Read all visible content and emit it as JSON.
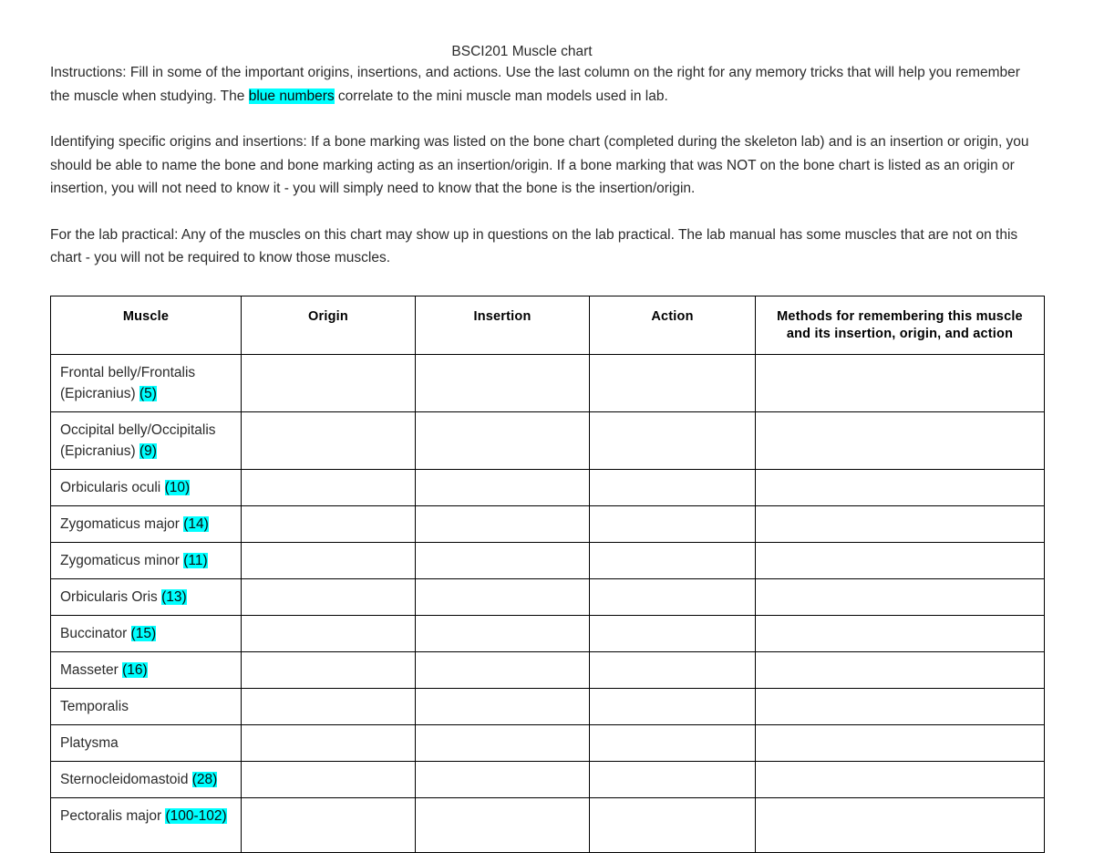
{
  "document": {
    "title": "BSCI201 Muscle chart",
    "paragraphs": {
      "instructions_part1": "Instructions: Fill in some of the important origins, insertions, and actions. Use the last column on the right for any memory tricks that will help you remember the muscle when studying. The ",
      "instructions_highlight": "blue numbers",
      "instructions_part2": " correlate to the mini muscle man models used in lab.",
      "identifying": "Identifying specific origins and insertions: If a bone marking was listed on the bone chart (completed during the skeleton lab) and is an insertion or origin, you should be able to name the bone and bone marking acting as an insertion/origin. If a bone marking that was NOT on the bone chart is listed as an origin or insertion, you will not need to know it - you will simply need to know that the bone is the insertion/origin.",
      "lab_practical": "For the lab practical: Any of the muscles on this chart may show up in questions on the lab practical. The lab manual has some muscles that are not on this chart - you will not be required to know those muscles."
    }
  },
  "colors": {
    "highlight": "#00ffff",
    "text": "#2b2b2b",
    "border": "#000000"
  },
  "table": {
    "headers": {
      "muscle": "Muscle",
      "origin": "Origin",
      "insertion": "Insertion",
      "action": "Action",
      "methods_line1": "Methods for remembering this muscle",
      "methods_line2": "and its insertion, origin, and action"
    },
    "rows": [
      {
        "name": "Frontal belly/Frontalis (Epicranius) ",
        "number": "(5)",
        "lines": 2,
        "origin": "",
        "insertion": "",
        "action": "",
        "methods": ""
      },
      {
        "name": "Occipital belly/Occipitalis (Epicranius) ",
        "number": "(9)",
        "lines": 2,
        "origin": "",
        "insertion": "",
        "action": "",
        "methods": ""
      },
      {
        "name": "Orbicularis oculi ",
        "number": "(10)",
        "lines": 1,
        "origin": "",
        "insertion": "",
        "action": "",
        "methods": ""
      },
      {
        "name": "Zygomaticus major ",
        "number": "(14)",
        "lines": 1,
        "origin": "",
        "insertion": "",
        "action": "",
        "methods": ""
      },
      {
        "name": "Zygomaticus minor ",
        "number": "(11)",
        "lines": 1,
        "origin": "",
        "insertion": "",
        "action": "",
        "methods": ""
      },
      {
        "name": "Orbicularis Oris ",
        "number": "(13)",
        "lines": 1,
        "origin": "",
        "insertion": "",
        "action": "",
        "methods": ""
      },
      {
        "name": "Buccinator ",
        "number": "(15)",
        "lines": 1,
        "origin": "",
        "insertion": "",
        "action": "",
        "methods": ""
      },
      {
        "name": "Masseter ",
        "number": "(16)",
        "lines": 1,
        "origin": "",
        "insertion": "",
        "action": "",
        "methods": ""
      },
      {
        "name": "Temporalis",
        "number": "",
        "lines": 1,
        "origin": "",
        "insertion": "",
        "action": "",
        "methods": ""
      },
      {
        "name": "Platysma",
        "number": "",
        "lines": 1,
        "origin": "",
        "insertion": "",
        "action": "",
        "methods": ""
      },
      {
        "name": "Sternocleidomastoid ",
        "number": "(28)",
        "lines": 1,
        "origin": "",
        "insertion": "",
        "action": "",
        "methods": ""
      },
      {
        "name": "Pectoralis major ",
        "number": "(100-102)",
        "lines": 2,
        "origin": "",
        "insertion": "",
        "action": "",
        "methods": ""
      }
    ]
  }
}
